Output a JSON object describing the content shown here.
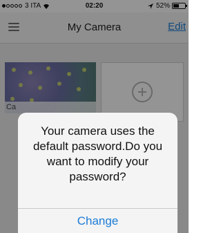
{
  "status_bar": {
    "carrier": "3 ITA",
    "time": "02:20",
    "battery": "52%",
    "battery_level": 0.52,
    "signal_bars_filled": 1,
    "signal_bars_total": 5,
    "icons": [
      "signal-dots-icon",
      "wifi-icon",
      "location-arrow-icon",
      "battery-icon"
    ]
  },
  "nav_bar": {
    "title": "My Camera",
    "edit_label": "Edit",
    "menu_icon": "hamburger-menu-icon"
  },
  "cameras": [
    {
      "label": "Ca"
    }
  ],
  "add_tile": {
    "icon": "plus-circle-icon"
  },
  "alert": {
    "message": "Your camera uses the default password.Do you want to modify your password?",
    "button_label": "Change"
  },
  "colors": {
    "accent": "#1a7bd6",
    "overlay": "rgba(0,0,0,0.42)",
    "nav_background": "#f7f7f7",
    "content_background": "#ececec"
  }
}
